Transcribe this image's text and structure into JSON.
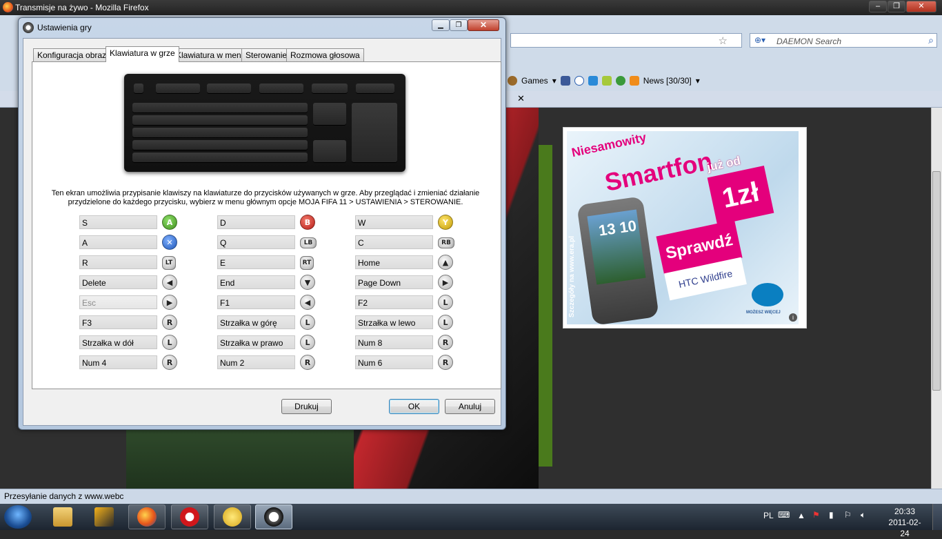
{
  "firefox": {
    "title": "Transmisje na żywo - Mozilla Firefox",
    "search_placeholder": "DAEMON Search",
    "bookmarks": [
      "Games",
      "News [30/30]"
    ],
    "status": "Przesyłanie danych z www.webc"
  },
  "ad": {
    "line1": "Niesamowity",
    "line2": "Smartfon",
    "line3": "już od",
    "price": "1zł",
    "cta": "Sprawdź",
    "model": "HTC Wildfire",
    "phone_clock": "13 10",
    "side_text": "Szczegóły na www.era.pl",
    "brand_tag": "MOŻESZ WIĘCEJ"
  },
  "dialog": {
    "title": "Ustawienia gry",
    "tabs": [
      "Konfiguracja obrazu",
      "Klawiatura w grze",
      "Klawiatura w menu",
      "Sterowanie",
      "Rozmowa głosowa"
    ],
    "selected_tab": "Klawiatura w grze",
    "description_1": "Ten ekran umożliwia przypisanie klawiszy na klawiaturze do przycisków używanych w grze. Aby przeglądać i zmieniać działanie",
    "description_2": "przydzielone do każdego przycisku, wybierz w menu głównym opcje MOJA FIFA 11 > USTAWIENIA > STEROWANIE.",
    "bindings": [
      [
        {
          "key": "S",
          "btn": "A"
        },
        {
          "key": "D",
          "btn": "B"
        },
        {
          "key": "W",
          "btn": "Y"
        }
      ],
      [
        {
          "key": "A",
          "btn": "X"
        },
        {
          "key": "Q",
          "btn": "LB"
        },
        {
          "key": "C",
          "btn": "RB"
        }
      ],
      [
        {
          "key": "R",
          "btn": "LT"
        },
        {
          "key": "E",
          "btn": "RT"
        },
        {
          "key": "Home",
          "btn": "dpad-up"
        }
      ],
      [
        {
          "key": "Delete",
          "btn": "dpad-left"
        },
        {
          "key": "End",
          "btn": "dpad-down"
        },
        {
          "key": "Page Down",
          "btn": "dpad-right"
        }
      ],
      [
        {
          "key": "Esc",
          "btn": "start"
        },
        {
          "key": "F1",
          "btn": "back"
        },
        {
          "key": "F2",
          "btn": "L"
        }
      ],
      [
        {
          "key": "F3",
          "btn": "R"
        },
        {
          "key": "Strzałka w górę",
          "btn": "L-up"
        },
        {
          "key": "Strzałka w lewo",
          "btn": "L-left"
        }
      ],
      [
        {
          "key": "Strzałka w dół",
          "btn": "L-down"
        },
        {
          "key": "Strzałka w prawo",
          "btn": "L-right"
        },
        {
          "key": "Num 8",
          "btn": "R-up"
        }
      ],
      [
        {
          "key": "Num 4",
          "btn": "R-left"
        },
        {
          "key": "Num 2",
          "btn": "R-down"
        },
        {
          "key": "Num 6",
          "btn": "R-right"
        }
      ]
    ],
    "print_label": "Drukuj",
    "ok_label": "OK",
    "cancel_label": "Anuluj"
  },
  "taskbar": {
    "language": "PL",
    "time": "20:33",
    "date": "2011-02-24"
  },
  "colors": {
    "btn_A": "#5cb02c",
    "btn_B": "#d1302a",
    "btn_X": "#2f6fd0",
    "btn_Y": "#e2b90f"
  }
}
